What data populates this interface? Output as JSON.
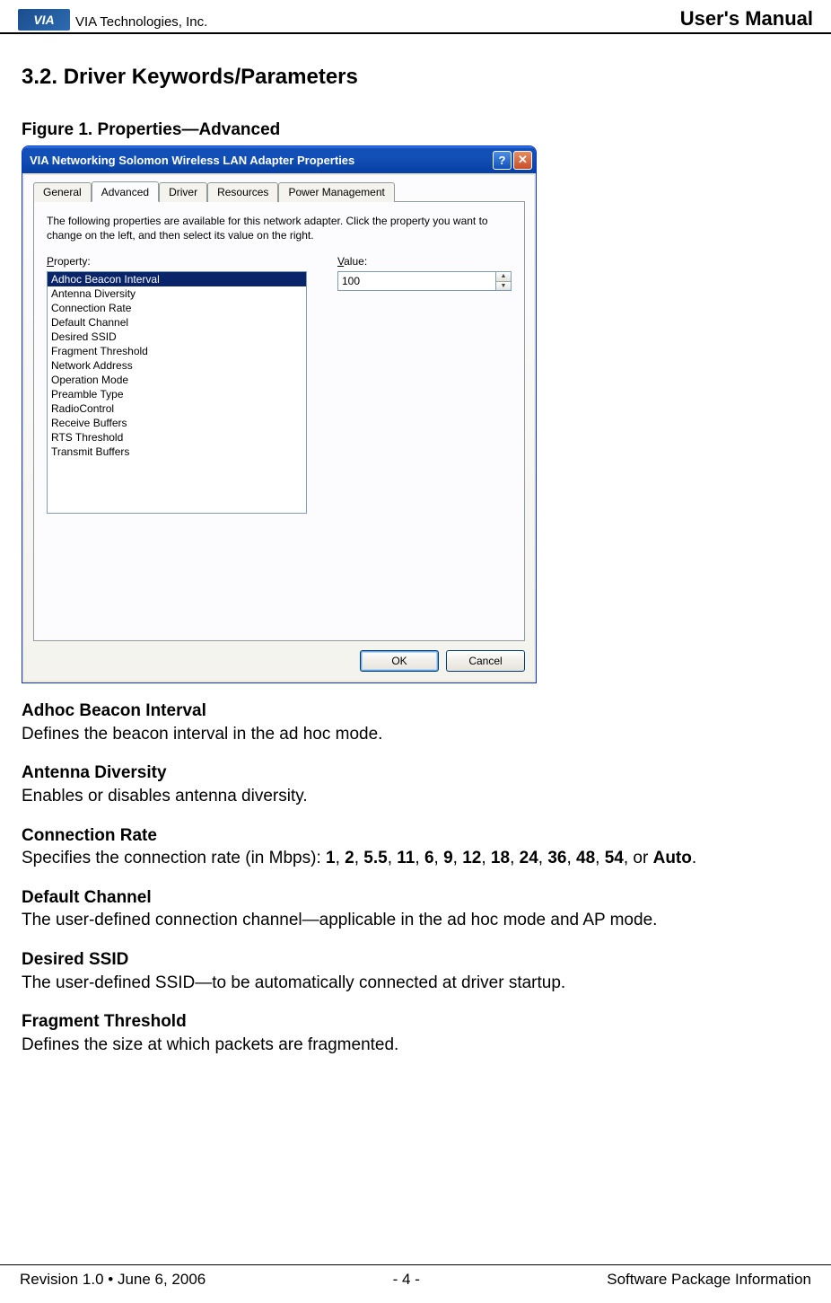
{
  "header": {
    "logo_text": "VIA",
    "company": "VIA Technologies, Inc.",
    "manual_title": "User's Manual"
  },
  "section": {
    "heading": "3.2. Driver Keywords/Parameters",
    "figure_caption": "Figure 1. Properties—Advanced"
  },
  "dialog": {
    "title": "VIA Networking Solomon Wireless LAN Adapter Properties",
    "help_glyph": "?",
    "close_glyph": "✕",
    "tabs": {
      "general": "General",
      "advanced": "Advanced",
      "driver": "Driver",
      "resources": "Resources",
      "power_management": "Power Management"
    },
    "panel_text": "The following properties are available for this network adapter. Click the property you want to change on the left, and then select its value on the right.",
    "property_label_u": "P",
    "property_label_rest": "roperty:",
    "value_label_u": "V",
    "value_label_rest": "alue:",
    "properties": [
      "Adhoc Beacon Interval",
      "Antenna Diversity",
      "Connection Rate",
      "Default Channel",
      "Desired SSID",
      "Fragment Threshold",
      "Network Address",
      "Operation Mode",
      "Preamble Type",
      "RadioControl",
      "Receive Buffers",
      "RTS Threshold",
      "Transmit Buffers"
    ],
    "value_input": "100",
    "spin_up": "▲",
    "spin_down": "▼",
    "buttons": {
      "ok": "OK",
      "cancel": "Cancel"
    }
  },
  "params": {
    "p1_title": "Adhoc Beacon Interval",
    "p1_desc": "Defines the beacon interval in the ad hoc mode.",
    "p2_title": "Antenna Diversity",
    "p2_desc": "Enables or disables antenna diversity.",
    "p3_title": "Connection Rate",
    "p3_desc_prefix": "Specifies the connection rate (in Mbps): ",
    "p3_desc_suffix": ".",
    "rates": {
      "or": ", or ",
      "r1": "1",
      "r2": "2",
      "r3": "5.5",
      "r4": "11",
      "r5": "6",
      "r6": "9",
      "r7": "12",
      "r8": "18",
      "r9": "24",
      "r10": "36",
      "r11": "48",
      "r12": "54",
      "auto": "Auto"
    },
    "comma": ", ",
    "p4_title": "Default Channel",
    "p4_desc": "The user-defined connection channel—applicable in the ad hoc mode and AP mode.",
    "p5_title": "Desired SSID",
    "p5_desc": "The user-defined SSID—to be automatically connected at driver startup.",
    "p6_title": "Fragment Threshold",
    "p6_desc": "Defines the size at which packets are fragmented."
  },
  "footer": {
    "revision": "Revision 1.0 • June 6, 2006",
    "page": "- 4 -",
    "section_name": "Software Package Information"
  }
}
